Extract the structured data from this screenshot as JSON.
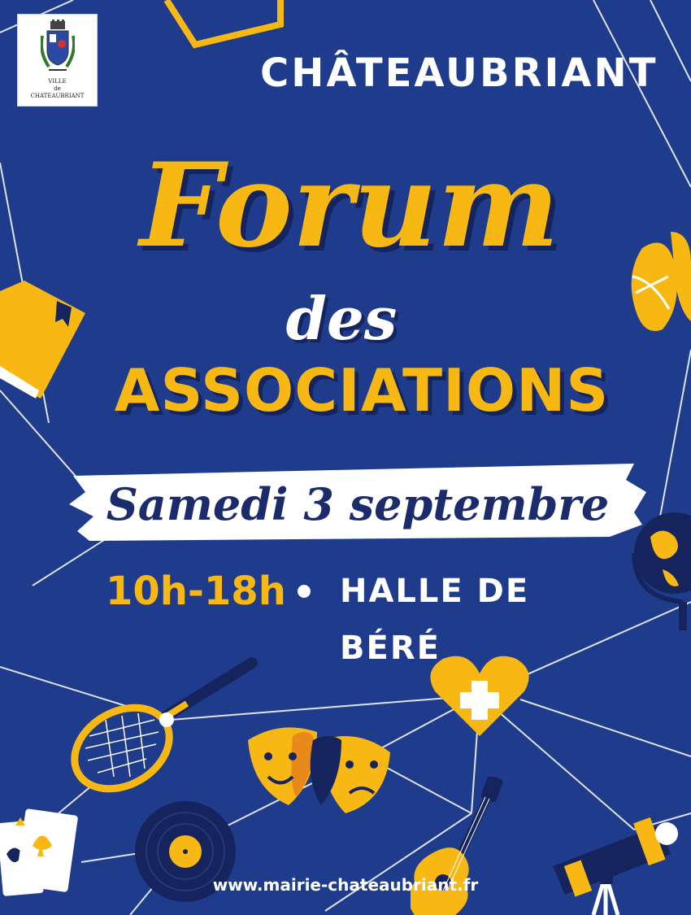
{
  "logo": {
    "line1": "VILLE",
    "line2": "de",
    "line3": "CHATEAUBRIANT"
  },
  "header": {
    "city": "CHÂTEAUBRIANT"
  },
  "title": {
    "forum": "Forum",
    "des": "des",
    "associations": "ASSOCIATIONS"
  },
  "event": {
    "date": "Samedi 3 septembre",
    "hours": "10h-18h",
    "place": "HALLE DE BÉRÉ"
  },
  "footer": {
    "url": "www.mairie-chateaubriant.fr"
  },
  "colors": {
    "background": "#1f3c8c",
    "accent_yellow": "#f7b813",
    "dark_navy": "#16245e",
    "white": "#ffffff"
  },
  "icons": [
    "coat-of-arms-icon",
    "book-icon",
    "ballet-shoe-icon",
    "globe-icon",
    "tennis-racket-icon",
    "heart-cross-icon",
    "theatre-masks-icon",
    "playing-cards-icon",
    "vinyl-record-icon",
    "guitar-icon",
    "telescope-icon"
  ]
}
